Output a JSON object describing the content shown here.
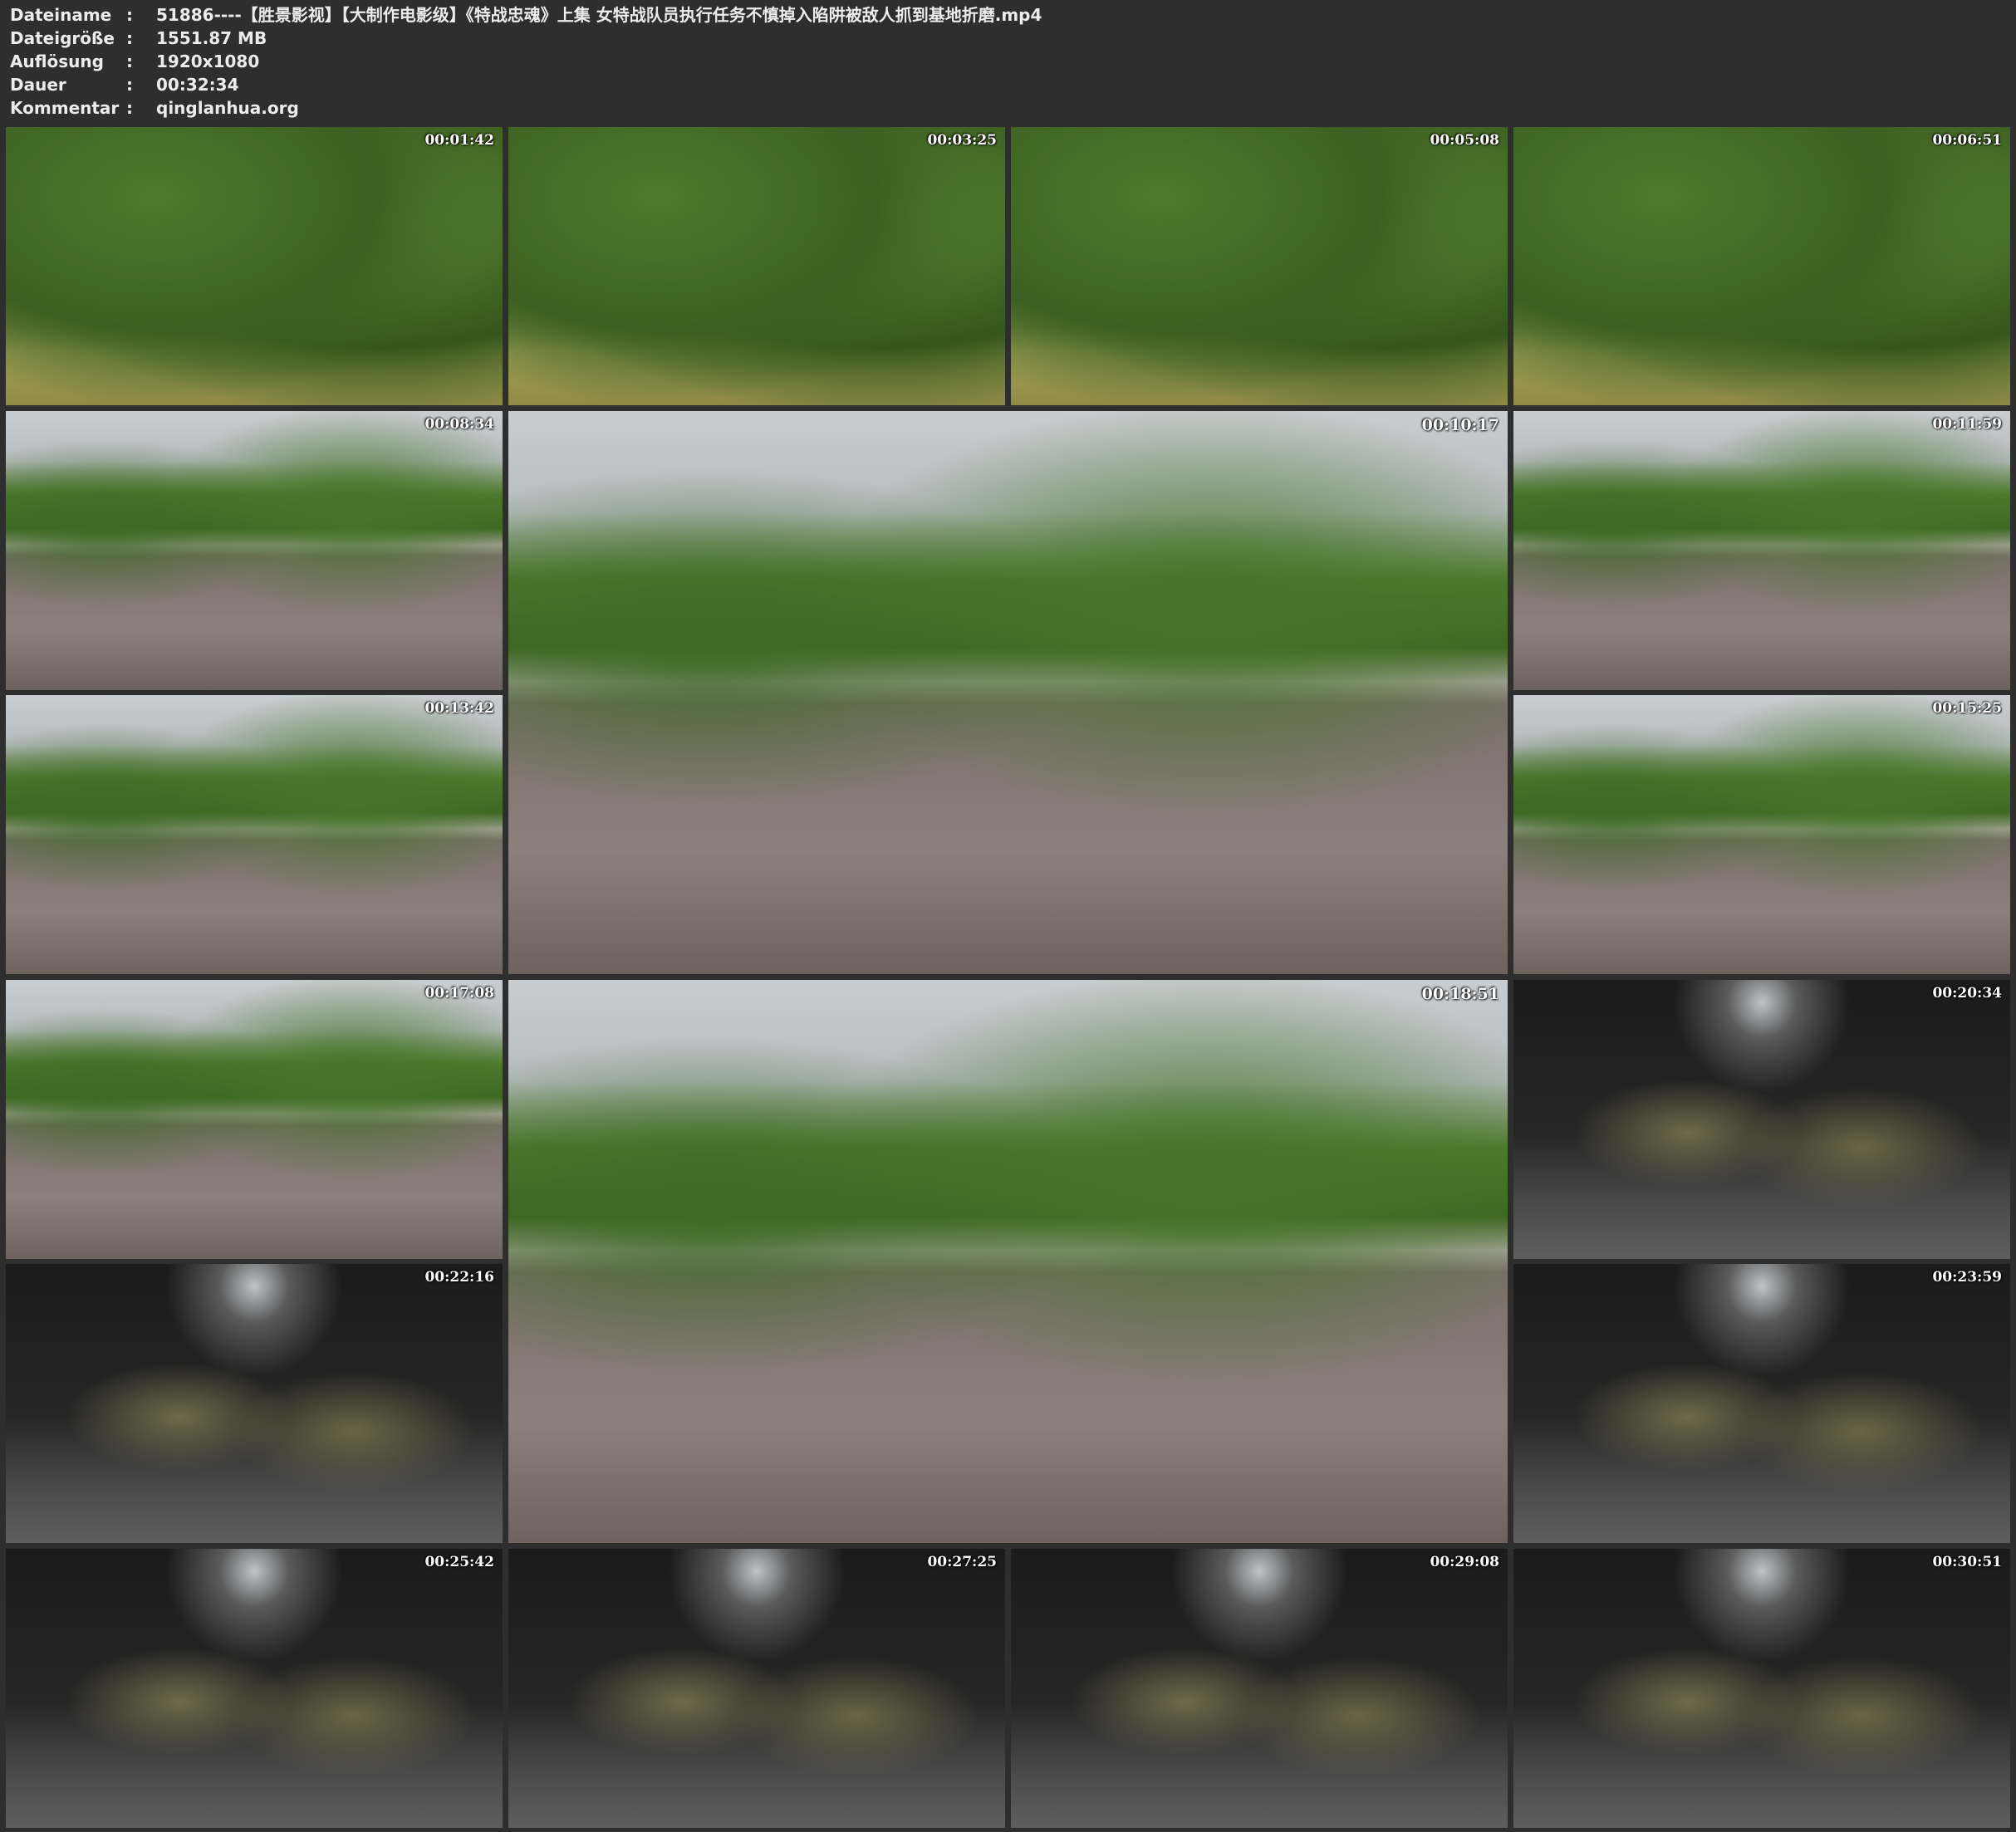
{
  "meta": [
    {
      "label": "Dateiname",
      "sep": ":",
      "value": "51886----【胜景影视】【大制作电影级】《特战忠魂》上集 女特战队员执行任务不慎掉入陷阱被敌人抓到基地折磨.mp4"
    },
    {
      "label": "Dateigröße",
      "sep": ":",
      "value": "1551.87 MB"
    },
    {
      "label": "Auflösung",
      "sep": ":",
      "value": "1920x1080"
    },
    {
      "label": "Dauer",
      "sep": ":",
      "value": "00:32:34"
    },
    {
      "label": "Kommentar",
      "sep": ":",
      "value": "qinglanhua.org"
    }
  ],
  "thumbnails": [
    {
      "timestamp": "00:01:42",
      "scene": "forest"
    },
    {
      "timestamp": "00:03:25",
      "scene": "forest"
    },
    {
      "timestamp": "00:05:08",
      "scene": "forest"
    },
    {
      "timestamp": "00:06:51",
      "scene": "forest"
    },
    {
      "timestamp": "00:08:34",
      "scene": "court"
    },
    {
      "timestamp": "00:10:17",
      "scene": "court"
    },
    {
      "timestamp": "00:11:59",
      "scene": "court"
    },
    {
      "timestamp": "00:13:42",
      "scene": "court"
    },
    {
      "timestamp": "00:15:25",
      "scene": "court"
    },
    {
      "timestamp": "00:17:08",
      "scene": "court"
    },
    {
      "timestamp": "00:18:51",
      "scene": "court"
    },
    {
      "timestamp": "00:20:34",
      "scene": "dark-room"
    },
    {
      "timestamp": "00:22:16",
      "scene": "dark-room"
    },
    {
      "timestamp": "00:23:59",
      "scene": "dark-room"
    },
    {
      "timestamp": "00:25:42",
      "scene": "dark-room"
    },
    {
      "timestamp": "00:27:25",
      "scene": "dark-room"
    },
    {
      "timestamp": "00:29:08",
      "scene": "dark-room"
    },
    {
      "timestamp": "00:30:51",
      "scene": "dark-room"
    }
  ],
  "colors": {
    "background": "#2e2e2e",
    "text": "#ececec",
    "forest_sky": "#e8ecef",
    "foliage": "#4f7a2c",
    "grass": "#a7a458",
    "court": "#7c6f6c",
    "dark_room": "#262626"
  }
}
